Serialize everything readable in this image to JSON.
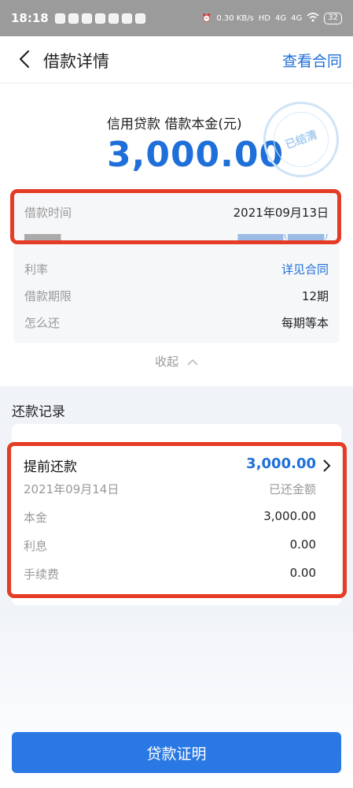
{
  "status_bar": {
    "time": "18:18",
    "net_speed_top": "0.30",
    "net_speed_unit": "KB/s",
    "hd_label": "HD",
    "signal_1": "4G",
    "signal_2": "4G",
    "battery": "32"
  },
  "nav": {
    "title": "借款详情",
    "right_link": "查看合同"
  },
  "summary": {
    "loan_type_line": "信用贷款 借款本金(元)",
    "principal": "3,000.00",
    "stamp_text": "已结清"
  },
  "details": {
    "rows": [
      {
        "label": "借款时间",
        "value": "2021年09月13日"
      },
      {
        "label": "利率",
        "value": "详见合同"
      },
      {
        "label": "借款期限",
        "value": "12期"
      },
      {
        "label": "怎么还",
        "value": "每期等本"
      }
    ],
    "collapse_label": "收起"
  },
  "repayment_records": {
    "section_title": "还款记录",
    "record": {
      "type": "提前还款",
      "amount": "3,000.00",
      "date": "2021年09月14日",
      "status": "已还金额",
      "rows": [
        {
          "label": "本金",
          "value": "3,000.00"
        },
        {
          "label": "利息",
          "value": "0.00"
        },
        {
          "label": "手续费",
          "value": "0.00"
        }
      ]
    }
  },
  "cta": {
    "label": "贷款证明"
  },
  "colors": {
    "accent": "#1e6fd9",
    "button": "#2a78e4",
    "highlight": "#e53c25"
  }
}
